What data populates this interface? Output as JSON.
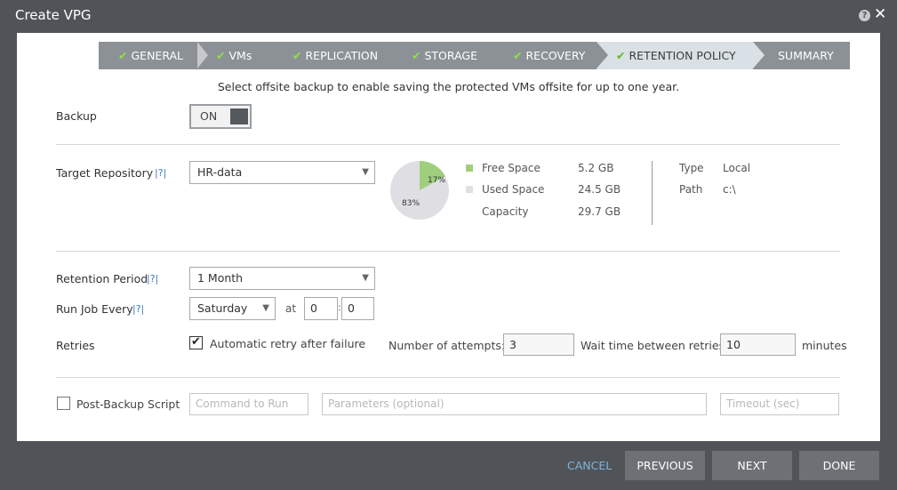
{
  "window": {
    "title": "Create VPG"
  },
  "wizard": {
    "steps": [
      {
        "label": "GENERAL",
        "done": true
      },
      {
        "label": "VMs",
        "done": true
      },
      {
        "label": "REPLICATION",
        "done": true
      },
      {
        "label": "STORAGE",
        "done": true
      },
      {
        "label": "RECOVERY",
        "done": true
      },
      {
        "label": "RETENTION POLICY",
        "done": true,
        "active": true
      },
      {
        "label": "SUMMARY",
        "done": false
      }
    ],
    "check_glyph": "✔"
  },
  "info_text": "Select offsite backup to enable saving the protected VMs offsite for up to one year.",
  "backup": {
    "label": "Backup",
    "toggle": "ON"
  },
  "repository": {
    "label": "Target Repository",
    "help": "|?|",
    "value": "HR-data",
    "pie": {
      "free_pct": 17,
      "used_pct": 83,
      "free_label": "17%",
      "used_label": "83%",
      "free_color": "#9fcf7c",
      "used_color": "#dfdfe3"
    },
    "free_label": "Free Space",
    "free_value": "5.2 GB",
    "used_label": "Used Space",
    "used_value": "24.5 GB",
    "capacity_label": "Capacity",
    "capacity_value": "29.7 GB",
    "type_label": "Type",
    "type_value": "Local",
    "path_label": "Path",
    "path_value": "c:\\"
  },
  "retention": {
    "label": "Retention Period",
    "help": "|?|",
    "value": "1 Month"
  },
  "runjob": {
    "label": "Run Job Every",
    "help": "|?|",
    "day": "Saturday",
    "at_label": "at",
    "hour": "0",
    "sep": ":",
    "minute": "0"
  },
  "retries": {
    "label": "Retries",
    "auto_label": "Automatic retry after failure",
    "attempts_label": "Number of attempts:",
    "attempts_value": "3",
    "wait_label": "Wait time between retries:",
    "wait_value": "10",
    "units": "minutes"
  },
  "post_script": {
    "label": "Post-Backup Script",
    "command_placeholder": "Command to Run",
    "params_placeholder": "Parameters (optional)",
    "timeout_placeholder": "Timeout (sec)"
  },
  "footer": {
    "cancel": "CANCEL",
    "previous": "PREVIOUS",
    "next": "NEXT",
    "done": "DONE"
  },
  "icons": {
    "help": "?",
    "close": "✕",
    "chevron": "▼"
  }
}
